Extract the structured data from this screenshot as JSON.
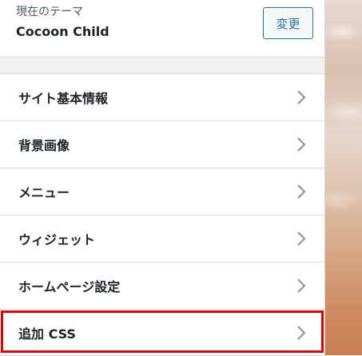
{
  "theme": {
    "label": "現在のテーマ",
    "name": "Cocoon Child",
    "change_button": "変更"
  },
  "menu": {
    "items": [
      {
        "label": "サイト基本情報",
        "icon": "chevron-right-icon"
      },
      {
        "label": "背景画像",
        "icon": "chevron-right-icon"
      },
      {
        "label": "メニュー",
        "icon": "chevron-right-icon"
      },
      {
        "label": "ウィジェット",
        "icon": "chevron-right-icon"
      },
      {
        "label": "ホームページ設定",
        "icon": "chevron-right-icon"
      },
      {
        "label": "追加 CSS",
        "icon": "chevron-right-icon"
      }
    ]
  },
  "highlight": {
    "target": "追加 CSS",
    "color": "#e00000"
  },
  "colors": {
    "button_accent": "#2271b1",
    "text": "#1d2327",
    "divider": "#dcdcde"
  }
}
